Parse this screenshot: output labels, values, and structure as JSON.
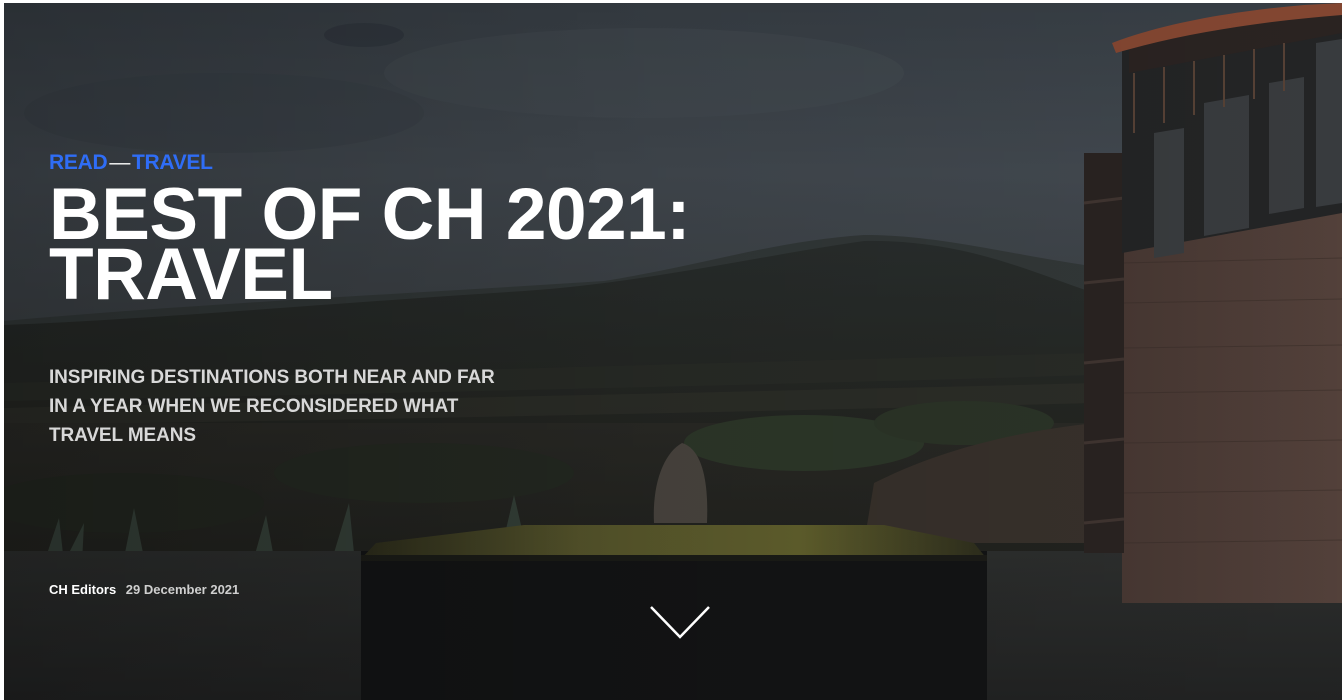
{
  "hero": {
    "kicker": {
      "section": "READ",
      "separator": "—",
      "category": "TRAVEL"
    },
    "title": "BEST OF CH 2021: TRAVEL",
    "subtitle": "INSPIRING DESTINATIONS BOTH NEAR AND FAR IN A YEAR WHEN WE RECONSIDERED WHAT TRAVEL MEANS",
    "byline": {
      "author": "CH Editors",
      "date": "29 December 2021"
    },
    "scroll_icon": "chevron-down-icon"
  },
  "colors": {
    "accent": "#2f6df6",
    "title": "#ffffff",
    "subtitle": "#d8d8d8"
  }
}
